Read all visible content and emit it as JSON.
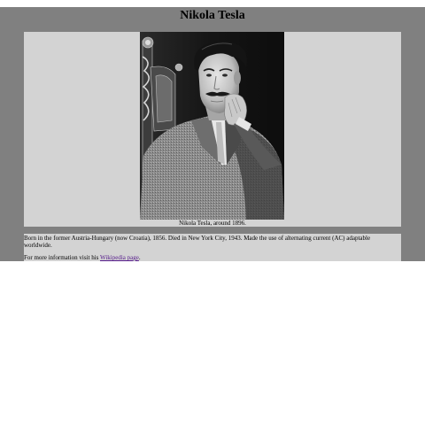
{
  "page": {
    "title": "Nikola Tesla"
  },
  "photo": {
    "caption": "Nikola Tesla, around 1896."
  },
  "bio": {
    "text": "Born in the former Austria-Hungary (now Croatia), 1856. Died in New York City, 1943. Made the use of alternating current (AC) adaptable worldwide.",
    "more_prefix": "For more information visit his ",
    "link_label": "Wikipedia page",
    "more_suffix": "."
  },
  "colors": {
    "page_background": "#808080",
    "panel_background": "#d3d3d3",
    "visited_link": "#551a8b"
  }
}
